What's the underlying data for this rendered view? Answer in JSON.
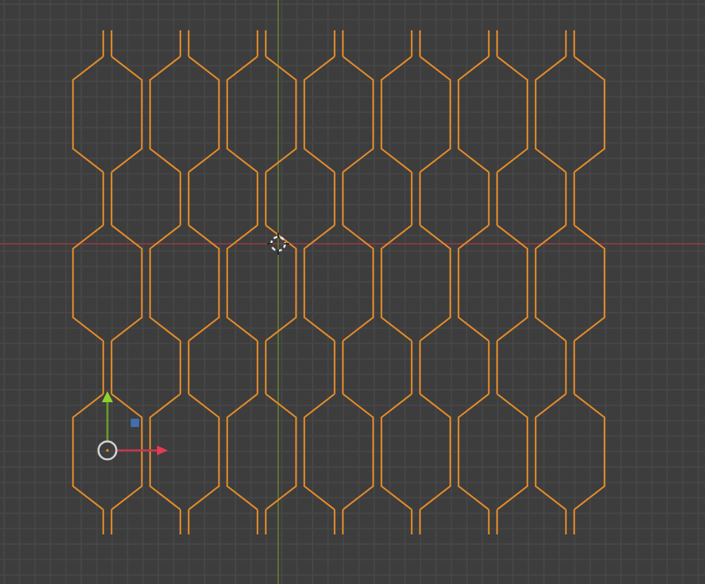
{
  "viewport": {
    "mesh": {
      "selected": true
    }
  }
}
